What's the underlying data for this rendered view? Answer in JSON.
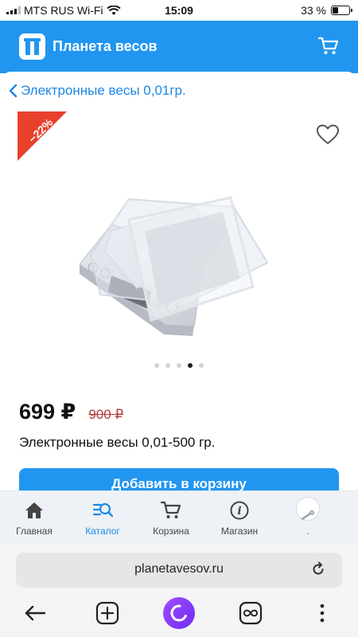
{
  "status_bar": {
    "carrier": "MTS RUS Wi-Fi",
    "time": "15:09",
    "battery": "33 %"
  },
  "app": {
    "title": "Планета весов"
  },
  "product": {
    "back_label": "Электронные весы 0,01гр.",
    "discount_badge": "−22%",
    "price": "699 ₽",
    "old_price": "900 ₽",
    "name": "Электронные весы 0,01-500 гр.",
    "add_to_cart": "Добавить в корзину",
    "gallery_dots": 5,
    "gallery_active_index": 3
  },
  "bottom_nav": {
    "items": [
      {
        "label": "Главная",
        "icon": "home-icon"
      },
      {
        "label": "Каталог",
        "icon": "catalog-search-icon",
        "active": true
      },
      {
        "label": "Корзина",
        "icon": "cart-icon"
      },
      {
        "label": "Магазин",
        "icon": "info-icon"
      },
      {
        "label": ".",
        "icon": "avatar"
      }
    ]
  },
  "browser": {
    "url": "planetavesov.ru"
  },
  "colors": {
    "brand_blue": "#2196f0",
    "discount_red": "#e8412c",
    "link_blue": "#1e88e5"
  }
}
